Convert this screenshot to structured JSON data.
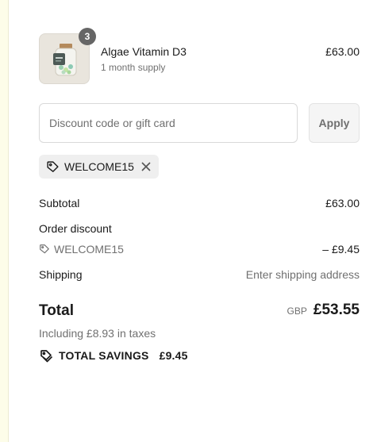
{
  "item": {
    "name": "Algae Vitamin D3",
    "variant": "1 month supply",
    "price": "£63.00",
    "quantity": "3",
    "image_icon": "supplement-jar-icon"
  },
  "discount": {
    "placeholder": "Discount code or gift card",
    "apply_label": "Apply",
    "applied_code": "WELCOME15"
  },
  "summary": {
    "subtotal_label": "Subtotal",
    "subtotal_value": "£63.00",
    "order_discount_label": "Order discount",
    "discount_code": "WELCOME15",
    "discount_value": "– £9.45",
    "shipping_label": "Shipping",
    "shipping_value": "Enter shipping address",
    "total_label": "Total",
    "currency": "GBP",
    "total_value": "£53.55",
    "taxes_note": "Including £8.93 in taxes",
    "savings_label": "TOTAL SAVINGS",
    "savings_value": "£9.45"
  },
  "colors": {
    "muted_text": "#707070",
    "badge": "#666666",
    "chip_bg": "#efefef",
    "left_strip": "#fdfde9"
  }
}
